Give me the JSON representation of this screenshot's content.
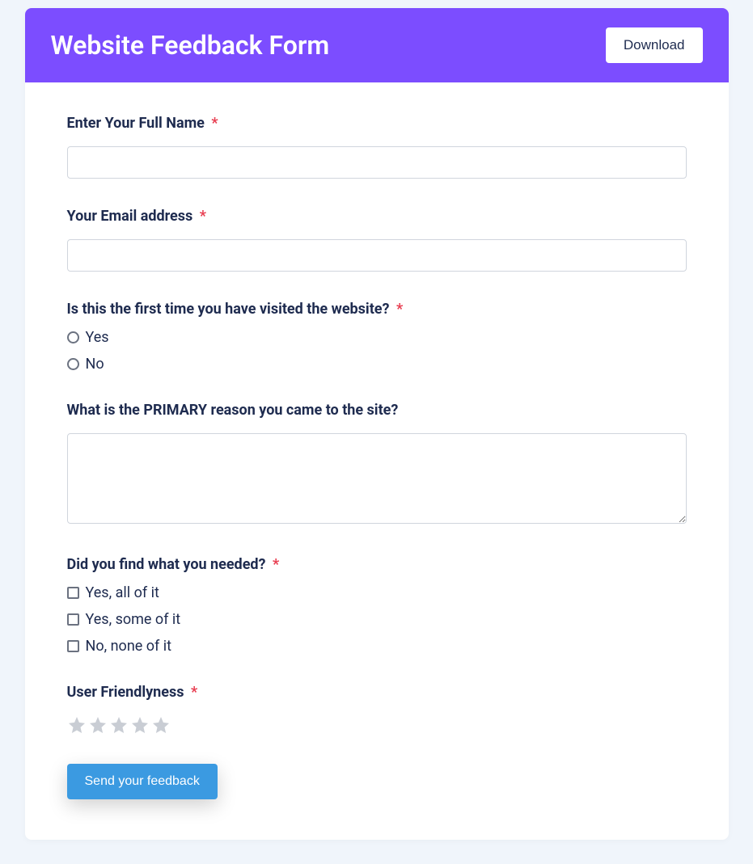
{
  "header": {
    "title": "Website Feedback Form",
    "download_label": "Download"
  },
  "fields": {
    "full_name": {
      "label": "Enter Your Full Name",
      "required": true,
      "value": ""
    },
    "email": {
      "label": "Your Email address",
      "required": true,
      "value": ""
    },
    "first_time": {
      "label": "Is this the first time you have visited the website?",
      "required": true,
      "options": [
        "Yes",
        "No"
      ]
    },
    "primary_reason": {
      "label": "What is the PRIMARY reason you came to the site?",
      "required": false,
      "value": ""
    },
    "found_needed": {
      "label": "Did you find what you needed?",
      "required": true,
      "options": [
        "Yes, all of it",
        "Yes, some of it",
        "No, none of it"
      ]
    },
    "user_friendly": {
      "label": "User Friendlyness",
      "required": true,
      "star_count": 5
    }
  },
  "submit_label": "Send your feedback",
  "required_marker": "*"
}
